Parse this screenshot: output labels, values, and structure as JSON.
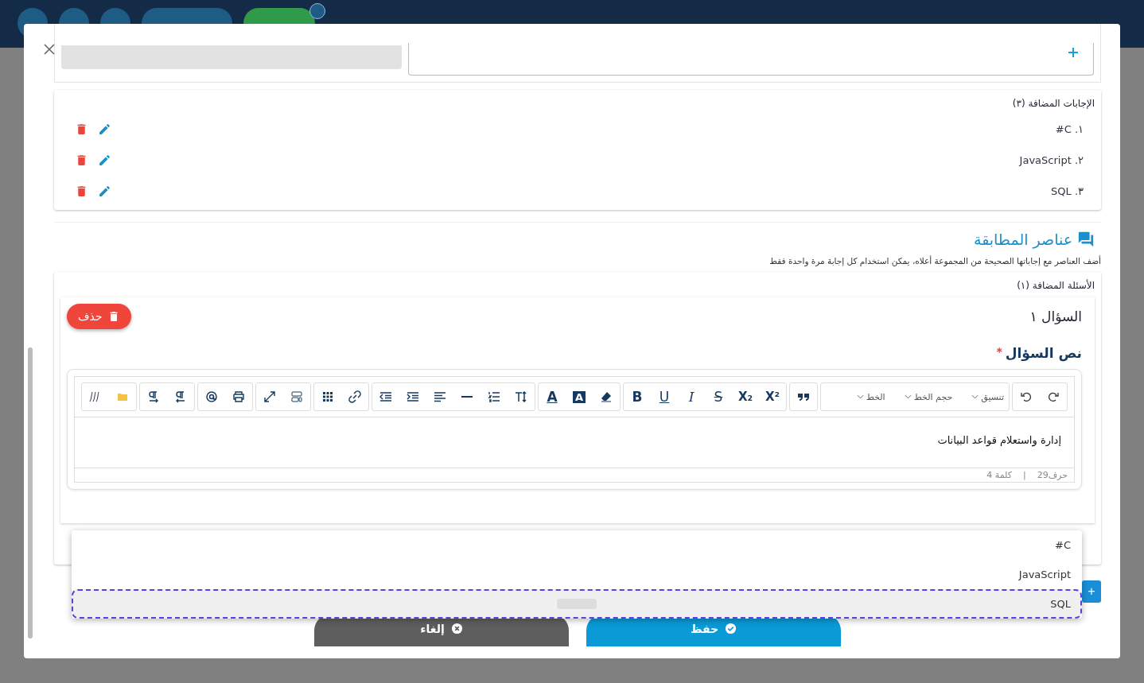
{
  "answers_card": {
    "title": "الإجابات المضافة (٣)",
    "items": [
      {
        "text": "١. C#"
      },
      {
        "text": "٢. JavaScript"
      },
      {
        "text": "٣. SQL"
      }
    ]
  },
  "matching": {
    "title": "عناصر المطابقة",
    "subtitle": "أضف العناصر مع إجاباتها الصحيحة من المجموعة أعلاه، يمكن استخدام كل إجابة مرة واحدة فقط"
  },
  "questions_card": {
    "title": "الأسئلة المضافة (١)",
    "question": {
      "title": "السؤال ١",
      "delete_label": "حذف",
      "field_label": "نص السؤال",
      "required_mark": "*",
      "editor": {
        "dropdowns": [
          "تنسيق",
          "حجم الخط",
          "الخط"
        ],
        "format_buttons": [
          "X²",
          "X₂",
          "S",
          "I",
          "U",
          "B"
        ],
        "color_buttons": [
          "A",
          "A"
        ],
        "content": "إدارة واستعلام قواعد البيانات",
        "char_count": "حرف29",
        "separator": "|",
        "word_count": "كلمة 4"
      }
    }
  },
  "answer_dropdown": {
    "options": [
      {
        "label": "C#",
        "selected": false
      },
      {
        "label": "JavaScript",
        "selected": false
      },
      {
        "label": "SQL",
        "selected": true
      }
    ]
  },
  "add_button": "+",
  "footer": {
    "save": "حفظ",
    "cancel": "إلغاء"
  }
}
